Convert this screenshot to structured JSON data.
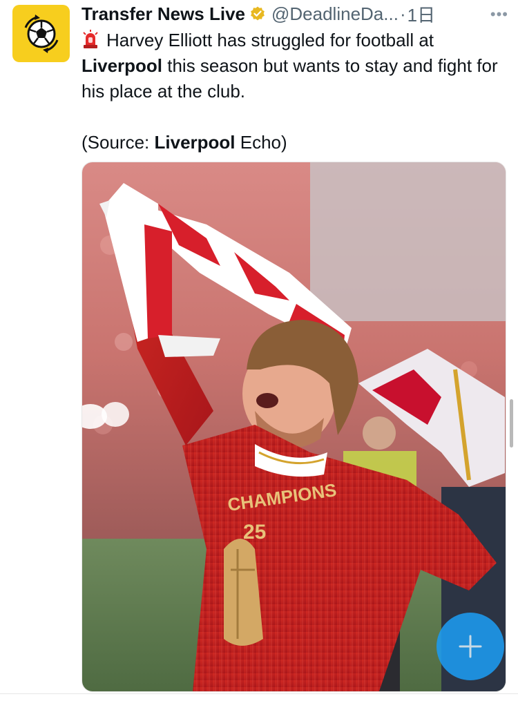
{
  "tweet": {
    "author_name": "Transfer News Live",
    "handle": "@DeadlineDa...",
    "separator": "·",
    "time": "1日",
    "more_label": "•••",
    "text_line1": "Harvey Elliott has struggled for football at",
    "text_bold1": "Liverpool",
    "text_line2": " this season but wants to stay and fight for his place at the club.",
    "source_prefix": "(Source: ",
    "source_bold": "Liverpool",
    "source_suffix": " Echo)",
    "media_alt": "Harvey Elliott celebrating with a Liverpool scarf",
    "shirt_text": "CHAMPIONS",
    "shirt_year": "25"
  },
  "icons": {
    "avatar": "soccer-ball-icon",
    "verified": "verified-badge-icon",
    "siren": "siren-icon",
    "compose": "plus-icon",
    "more": "more-dots-icon"
  },
  "colors": {
    "avatar_bg": "#f7ce1e",
    "verified": "#e8b821",
    "fab": "#1d9bf0",
    "liverpool_red": "#c8102e"
  }
}
